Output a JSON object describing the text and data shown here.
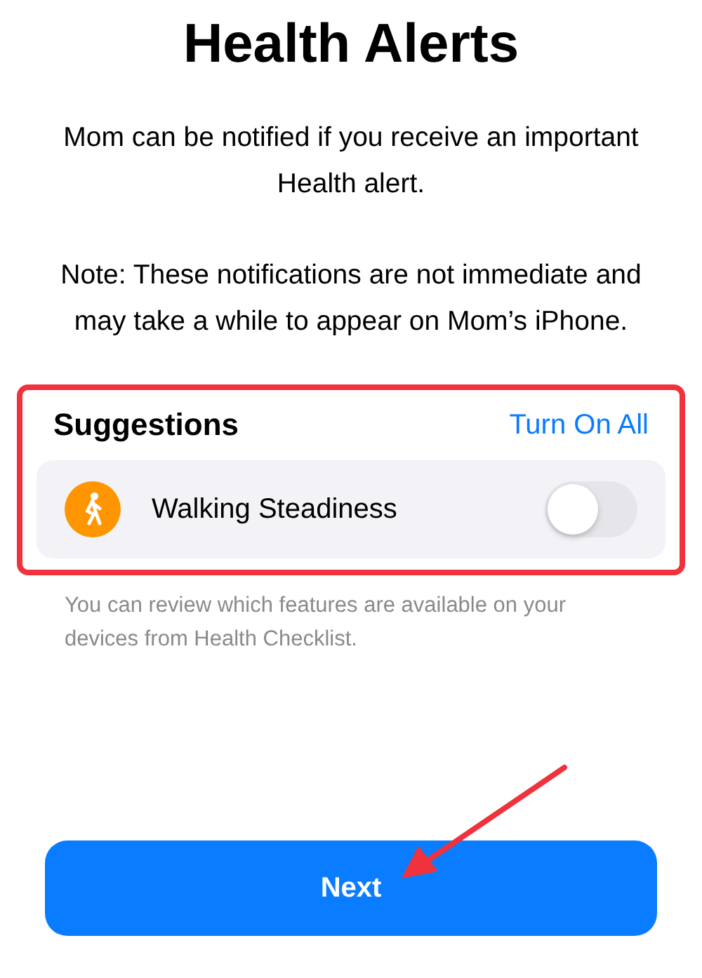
{
  "title": "Health Alerts",
  "paragraphs": [
    "Mom can be notified if you receive an important Health alert.",
    "Note: These notifications are not immediate and may take a while to appear on Mom’s iPhone."
  ],
  "suggestions": {
    "heading": "Suggestions",
    "action": "Turn On All",
    "items": [
      {
        "label": "Walking Steadiness",
        "on": false
      }
    ]
  },
  "footnote": "You can review which features are available on your devices from Health Checklist.",
  "button": "Next"
}
